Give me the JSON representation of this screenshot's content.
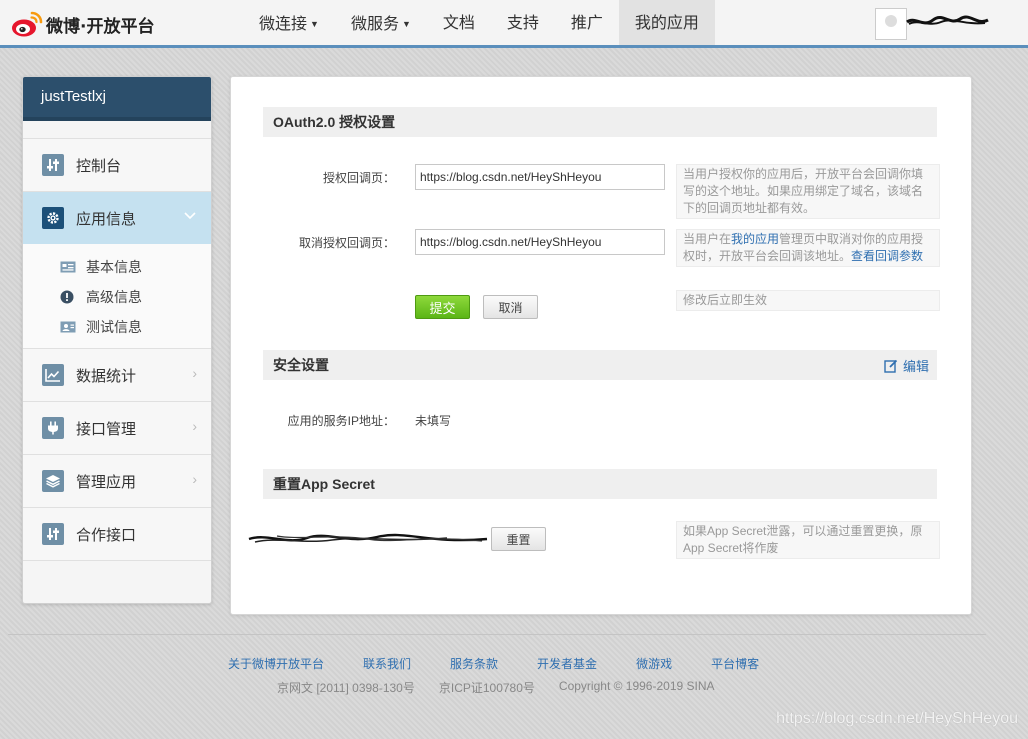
{
  "header": {
    "logo_text": "微博·开放平台",
    "nav": [
      {
        "label": "微连接",
        "caret": true
      },
      {
        "label": "微服务",
        "caret": true
      },
      {
        "label": "文档",
        "caret": false
      },
      {
        "label": "支持",
        "caret": false
      },
      {
        "label": "推广",
        "caret": false
      },
      {
        "label": "我的应用",
        "caret": false,
        "active": true
      }
    ],
    "caret_glyph": "▼"
  },
  "sidebar": {
    "app_name": "justTestlxj",
    "items": [
      {
        "label": "控制台",
        "icon": "sliders-icon"
      },
      {
        "label": "应用信息",
        "icon": "gear-icon",
        "active": true
      },
      {
        "label": "数据统计",
        "icon": "line-chart-icon"
      },
      {
        "label": "接口管理",
        "icon": "plug-icon"
      },
      {
        "label": "管理应用",
        "icon": "layers-icon"
      },
      {
        "label": "合作接口",
        "icon": "sliders-icon"
      }
    ],
    "sub_items": [
      {
        "label": "基本信息",
        "icon": "card-icon"
      },
      {
        "label": "高级信息",
        "icon": "info-icon"
      },
      {
        "label": "测试信息",
        "icon": "user-card-icon"
      }
    ],
    "chevron_right": "›",
    "chevron_down": "⌄"
  },
  "oauth": {
    "title": "OAuth2.0 授权设置",
    "callback_label": "授权回调页：",
    "callback_value": "https://blog.csdn.net/HeyShHeyou",
    "callback_hint": "当用户授权你的应用后，开放平台会回调你填写的这个地址。如果应用绑定了域名，该域名下的回调页地址都有效。",
    "cancel_label": "取消授权回调页：",
    "cancel_value": "https://blog.csdn.net/HeyShHeyou",
    "cancel_hint_prefix": "当用户在",
    "cancel_hint_link": "我的应用",
    "cancel_hint_middle": "管理页中取消对你的应用授权时，开放平台会回调该地址。",
    "cancel_hint_link2": "查看回调参数",
    "submit_label": "提交",
    "cancel_button": "取消",
    "submit_hint": "修改后立即生效"
  },
  "security": {
    "title": "安全设置",
    "edit_label": "编辑",
    "ip_label": "应用的服务IP地址：",
    "ip_value": "未填写"
  },
  "secret": {
    "title": "重置App Secret",
    "reset_label": "重置",
    "hint": "如果App Secret泄露，可以通过重置更换，原App Secret将作废"
  },
  "footer": {
    "links": [
      "关于微博开放平台",
      "联系我们",
      "服务条款",
      "开发者基金",
      "微游戏",
      "平台博客"
    ],
    "copyright": [
      "京网文 [2011] 0398-130号",
      "京ICP证100780号",
      "Copyright © 1996-2019 SINA"
    ],
    "watermark": "https://blog.csdn.net/HeyShHeyou"
  },
  "colors": {
    "header_border": "#5b8fbc",
    "sidebar_head": "#2c4f6c",
    "active_item": "#c5e1f0",
    "link": "#2f6fb0",
    "submit_green": "#5bb516"
  }
}
